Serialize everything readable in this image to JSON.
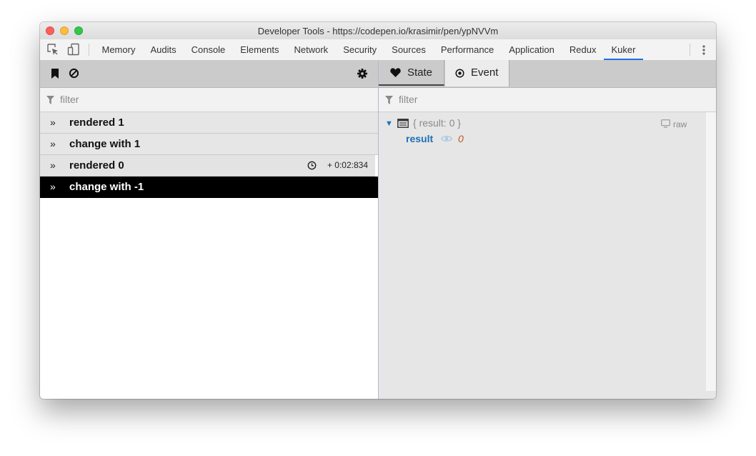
{
  "window": {
    "title": "Developer Tools - https://codepen.io/krasimir/pen/ypNVVm"
  },
  "devtools_tabs": [
    {
      "label": "Memory"
    },
    {
      "label": "Audits"
    },
    {
      "label": "Console"
    },
    {
      "label": "Elements"
    },
    {
      "label": "Network"
    },
    {
      "label": "Security"
    },
    {
      "label": "Sources"
    },
    {
      "label": "Performance"
    },
    {
      "label": "Application"
    },
    {
      "label": "Redux"
    },
    {
      "label": "Kuker",
      "active": true
    }
  ],
  "left_panel": {
    "filter_placeholder": "filter",
    "events": [
      {
        "label": "rendered 1"
      },
      {
        "label": "change with 1"
      },
      {
        "label": "rendered 0",
        "time": "+ 0:02:834"
      },
      {
        "label": "change with -1",
        "selected": true
      }
    ]
  },
  "right_panel": {
    "tabs": [
      {
        "label": "State",
        "active": true,
        "icon": "heart-icon"
      },
      {
        "label": "Event",
        "icon": "target-icon"
      }
    ],
    "filter_placeholder": "filter",
    "tree": {
      "summary": "{ result: 0 }",
      "raw_label": "raw",
      "key": "result",
      "value": "0"
    }
  },
  "colors": {
    "accent": "#1a73e8",
    "selected_row": "#000000",
    "key_color": "#1e6fb3",
    "value_color": "#b85a1f"
  }
}
